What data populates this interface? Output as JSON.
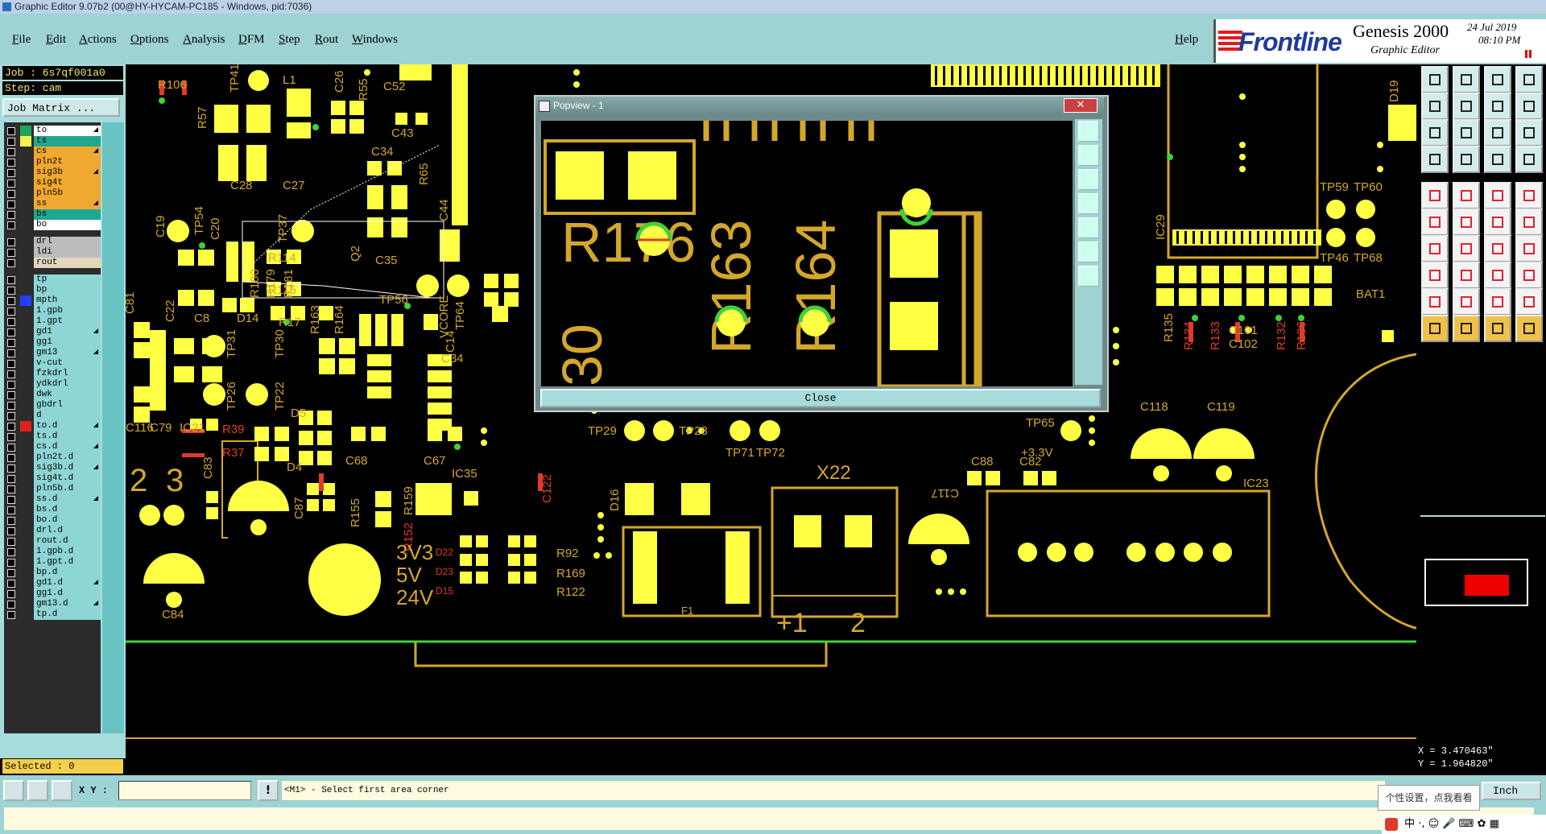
{
  "window": {
    "title": "Graphic Editor 9.07b2 (00@HY-HYCAM-PC185 - Windows, pid:7036)"
  },
  "menu": {
    "items": [
      "File",
      "Edit",
      "Actions",
      "Options",
      "Analysis",
      "DFM",
      "Step",
      "Rout",
      "Windows"
    ],
    "help": "Help"
  },
  "logo": {
    "brand": "Frontline",
    "product": "Genesis 2000",
    "subtitle": "Graphic Editor",
    "date": "24 Jul 2019",
    "time": "08:10 PM"
  },
  "job": {
    "job_line": "Job : 6s7qf001a0",
    "step_line": "Step: cam",
    "matrix_button": "Job Matrix ..."
  },
  "layers": [
    {
      "name": "to",
      "color": "#ffffff",
      "swatch": "#1fa55a",
      "arrow": true
    },
    {
      "name": "ts",
      "color": "#1fa88f",
      "swatch": "#f2f24a",
      "arrow": false
    },
    {
      "name": "cs",
      "color": "#f0a830",
      "swatch": "",
      "arrow": true
    },
    {
      "name": "pln2t",
      "color": "#f0a830",
      "swatch": "",
      "arrow": false
    },
    {
      "name": "sig3b",
      "color": "#f0a830",
      "swatch": "",
      "arrow": true
    },
    {
      "name": "sig4t",
      "color": "#f0a830",
      "swatch": "",
      "arrow": false
    },
    {
      "name": "pln5b",
      "color": "#f0a830",
      "swatch": "",
      "arrow": false
    },
    {
      "name": "ss",
      "color": "#f0a830",
      "swatch": "",
      "arrow": true
    },
    {
      "name": "bs",
      "color": "#1fa88f",
      "swatch": "",
      "arrow": false
    },
    {
      "name": "bo",
      "color": "#ffffff",
      "swatch": "",
      "arrow": false
    },
    {
      "name": "drl",
      "color": "#bcbcbc",
      "swatch": "",
      "arrow": false
    },
    {
      "name": "ldi",
      "color": "#bcbcbc",
      "swatch": "",
      "arrow": false
    },
    {
      "name": "rout",
      "color": "#e3d6bc",
      "swatch": "",
      "arrow": false
    },
    {
      "name": "tp",
      "color": "#8ed6d6",
      "swatch": "",
      "arrow": false
    },
    {
      "name": "bp",
      "color": "#8ed6d6",
      "swatch": "",
      "arrow": false
    },
    {
      "name": "mpth",
      "color": "#8ed6d6",
      "swatch": "#2040ff",
      "arrow": false
    },
    {
      "name": "1.gpb",
      "color": "#8ed6d6",
      "swatch": "",
      "arrow": false
    },
    {
      "name": "1.gpt",
      "color": "#8ed6d6",
      "swatch": "",
      "arrow": false
    },
    {
      "name": "gd1",
      "color": "#8ed6d6",
      "swatch": "",
      "arrow": true
    },
    {
      "name": "gg1",
      "color": "#8ed6d6",
      "swatch": "",
      "arrow": false
    },
    {
      "name": "gm13",
      "color": "#8ed6d6",
      "swatch": "",
      "arrow": true
    },
    {
      "name": "v-cut",
      "color": "#8ed6d6",
      "swatch": "",
      "arrow": false
    },
    {
      "name": "fzkdrl",
      "color": "#8ed6d6",
      "swatch": "",
      "arrow": false
    },
    {
      "name": "ydkdrl",
      "color": "#8ed6d6",
      "swatch": "",
      "arrow": false
    },
    {
      "name": "dwk",
      "color": "#8ed6d6",
      "swatch": "",
      "arrow": false
    },
    {
      "name": "gbdrl",
      "color": "#8ed6d6",
      "swatch": "",
      "arrow": false
    },
    {
      "name": "d",
      "color": "#8ed6d6",
      "swatch": "",
      "arrow": false
    },
    {
      "name": "to.d",
      "color": "#8ed6d6",
      "swatch": "#e02020",
      "arrow": true
    },
    {
      "name": "ts.d",
      "color": "#8ed6d6",
      "swatch": "",
      "arrow": false
    },
    {
      "name": "cs.d",
      "color": "#8ed6d6",
      "swatch": "",
      "arrow": true
    },
    {
      "name": "pln2t.d",
      "color": "#8ed6d6",
      "swatch": "",
      "arrow": false
    },
    {
      "name": "sig3b.d",
      "color": "#8ed6d6",
      "swatch": "",
      "arrow": true
    },
    {
      "name": "sig4t.d",
      "color": "#8ed6d6",
      "swatch": "",
      "arrow": false
    },
    {
      "name": "pln5b.d",
      "color": "#8ed6d6",
      "swatch": "",
      "arrow": false
    },
    {
      "name": "ss.d",
      "color": "#8ed6d6",
      "swatch": "",
      "arrow": true
    },
    {
      "name": "bs.d",
      "color": "#8ed6d6",
      "swatch": "",
      "arrow": false
    },
    {
      "name": "bo.d",
      "color": "#8ed6d6",
      "swatch": "",
      "arrow": false
    },
    {
      "name": "drl.d",
      "color": "#8ed6d6",
      "swatch": "",
      "arrow": false
    },
    {
      "name": "rout.d",
      "color": "#8ed6d6",
      "swatch": "",
      "arrow": false
    },
    {
      "name": "1.gpb.d",
      "color": "#8ed6d6",
      "swatch": "",
      "arrow": false
    },
    {
      "name": "1.gpt.d",
      "color": "#8ed6d6",
      "swatch": "",
      "arrow": false
    },
    {
      "name": "bp.d",
      "color": "#8ed6d6",
      "swatch": "",
      "arrow": false
    },
    {
      "name": "gd1.d",
      "color": "#8ed6d6",
      "swatch": "",
      "arrow": true
    },
    {
      "name": "gg1.d",
      "color": "#8ed6d6",
      "swatch": "",
      "arrow": false
    },
    {
      "name": "gm13.d",
      "color": "#8ed6d6",
      "swatch": "",
      "arrow": true
    },
    {
      "name": "tp.d",
      "color": "#8ed6d6",
      "swatch": "",
      "arrow": false
    }
  ],
  "selected": "Selected : 0",
  "popview": {
    "title": "Popview - 1",
    "close_label": "Close",
    "labels": [
      "R176",
      "R163",
      "R164",
      "30"
    ]
  },
  "pcb_labels": [
    "R106",
    "TP41",
    "L1",
    "C26",
    "R55",
    "C52",
    "C30",
    "D19",
    "R57",
    "C43",
    "C28",
    "C27",
    "C34",
    "R65",
    "C44",
    "C19",
    "C20",
    "TP54",
    "TP37",
    "Q2",
    "C35",
    "R114",
    "R115",
    "TP56",
    "R180",
    "R179",
    "R181",
    "TP64",
    "VCORE",
    "C14",
    "C81",
    "C22",
    "C8",
    "D14",
    "R17",
    "R163",
    "R164",
    "C34",
    "TP31",
    "TP30",
    "TP26",
    "TP22",
    "D5",
    "C116",
    "C79",
    "IC21",
    "R39",
    "R37",
    "C68",
    "C67",
    "D4",
    "C83",
    "C87",
    "R155",
    "R159",
    "IC35",
    "R152",
    "C122",
    "D16",
    "F1",
    "TP29",
    "TP28",
    "TP71",
    "TP72",
    "X22",
    "C117",
    "C88",
    "C82",
    "IC23",
    "C118",
    "C119",
    "TP65",
    "+3.3V",
    "TP59",
    "TP60",
    "TP46",
    "TP68",
    "BAT1",
    "R135",
    "R134",
    "R133",
    "C101",
    "C102",
    "R132",
    "R136",
    "IC29",
    "C84",
    "3V3",
    "5V",
    "24V",
    "R92",
    "R169",
    "R122",
    "D22",
    "D23",
    "D15",
    "2",
    "3",
    "+1",
    "2"
  ],
  "coords": {
    "x": "X = 3.470463\"",
    "y": "Y = 1.964820\""
  },
  "bottom": {
    "xy_label": "X Y :",
    "xy_value": "",
    "message": "<M1> - Select first area corner",
    "units": "Inch"
  },
  "tooltip": "个性设置，点我看看",
  "ime": {
    "text": "中 ·, ☺ 🎤 ⌨ ✿ ▦"
  }
}
